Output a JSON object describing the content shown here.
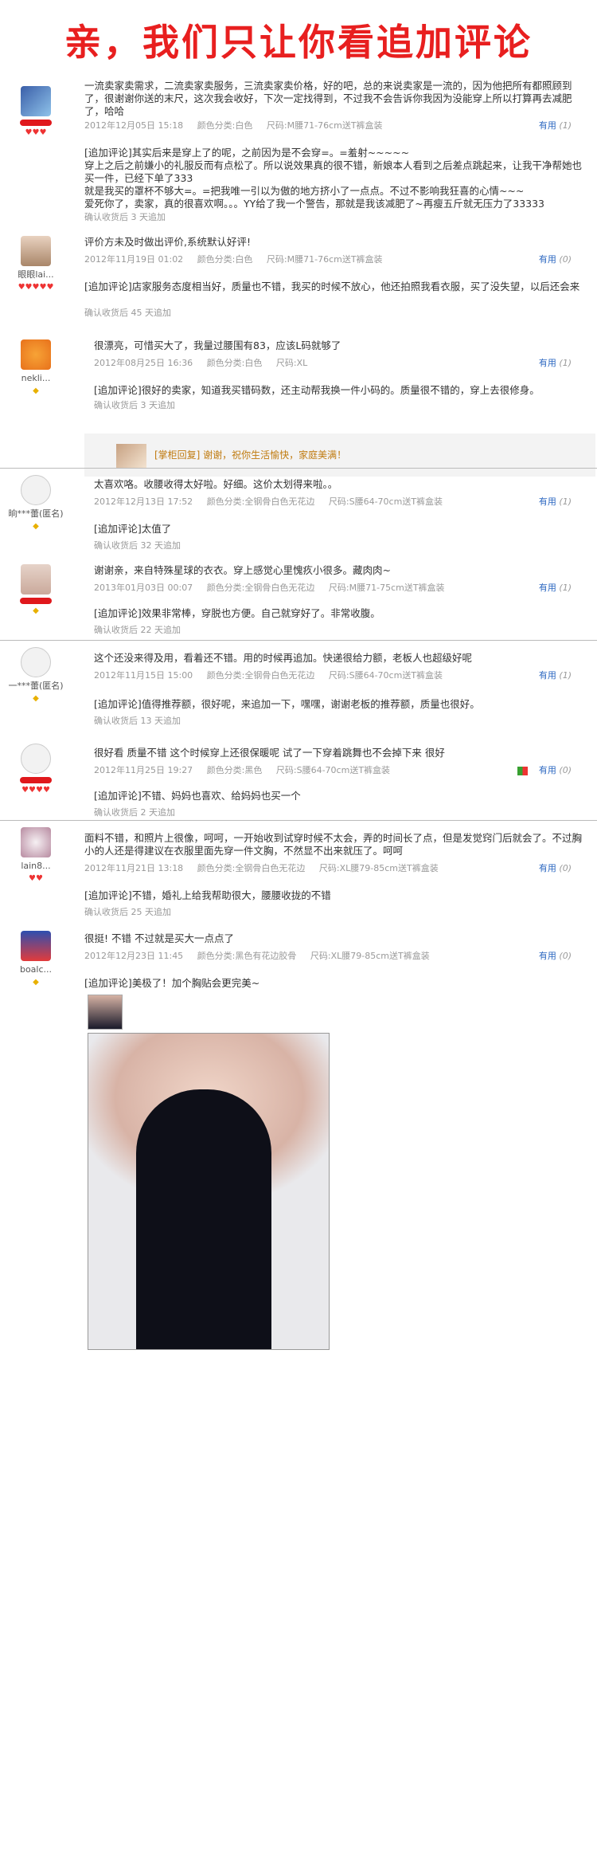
{
  "banner": {
    "title": "亲，我们只让你看追加评论"
  },
  "labels": {
    "helpful": "有用"
  },
  "reviews": [
    {
      "user": {
        "name": "",
        "credit": "♥♥♥"
      },
      "text": "一流卖家卖需求，二流卖家卖服务，三流卖家卖价格，好的吧，总的来说卖家是一流的，因为他把所有都照顾到了，很谢谢你送的末尺，这次我会收好，下次一定找得到，不过我不会告诉你我因为没能穿上所以打算再去减肥了，哈哈",
      "date": "2012年12月05日 15:18",
      "color": "颜色分类:白色",
      "size": "尺码:M腰71-76cm送T裤盒装",
      "helpful_count": "(1)",
      "followup": "[追加评论]其实后来是穿上了的呢，之前因为是不会穿=。=羞射~~~~~\n穿上之后之前嫌小的礼服反而有点松了。所以说效果真的很不错，新娘本人看到之后差点跳起来，让我干净帮她也买一件，已经下单了333\n就是我买的罩杯不够大=。=把我唯一引以为傲的地方挤小了一点点。不过不影响我狂喜的心情~~~\n爱死你了，卖家，真的很喜欢啊。。。YY给了我一个警告，那就是我该减肥了~再瘦五斤就无压力了33333",
      "followup_date": "确认收货后 3 天追加"
    },
    {
      "user": {
        "name": "眼眼lai...",
        "credit": "♥♥♥♥♥"
      },
      "text": "评价方未及时做出评价,系统默认好评!",
      "date": "2012年11月19日 01:02",
      "color": "颜色分类:白色",
      "size": "尺码:M腰71-76cm送T裤盒装",
      "helpful_count": "(0)",
      "followup": "[追加评论]店家服务态度相当好，质量也不错，我买的时候不放心，他还拍照我看衣服，买了没失望，以后还会来",
      "followup_date": "确认收货后 45 天追加"
    },
    {
      "user": {
        "name": "nekli...",
        "credit": "◆"
      },
      "text": "很漂亮，可惜买大了，我量过腰围有83，应该L码就够了",
      "date": "2012年08月25日 16:36",
      "color": "颜色分类:白色",
      "size": "尺码:XL",
      "helpful_count": "(1)",
      "followup": "[追加评论]很好的卖家，知道我买错码数，还主动帮我换一件小码的。质量很不错的，穿上去很修身。",
      "followup_date": "确认收货后 3 天追加",
      "reply": "[掌柜回复] 谢谢，祝你生活愉快，家庭美满！"
    },
    {
      "user": {
        "name": "晌***蕾(匿名)",
        "credit": "◆"
      },
      "text": "太喜欢咯。收腰收得太好啦。好细。这价太划得来啦。。",
      "date": "2012年12月13日 17:52",
      "color": "颜色分类:全钢骨白色无花边",
      "size": "尺码:S腰64-70cm送T裤盒装",
      "helpful_count": "(1)",
      "followup": "[追加评论]太值了",
      "followup_date": "确认收货后 32 天追加"
    },
    {
      "user": {
        "name": "",
        "credit": "◆"
      },
      "text": "谢谢亲，来自特殊星球的衣衣。穿上感觉心里愧疚小很多。藏肉肉~",
      "date": "2013年01月03日 00:07",
      "color": "颜色分类:全钢骨白色无花边",
      "size": "尺码:M腰71-75cm送T裤盒装",
      "helpful_count": "(1)",
      "followup": "[追加评论]效果非常棒，穿脱也方便。自己就穿好了。非常收腹。",
      "followup_date": "确认收货后 22 天追加"
    },
    {
      "user": {
        "name": "一***蕾(匿名)",
        "credit": "◆"
      },
      "text": "这个还没来得及用，看着还不错。用的时候再追加。快递很给力额，老板人也超级好呢",
      "date": "2012年11月15日 15:00",
      "color": "颜色分类:全钢骨白色无花边",
      "size": "尺码:S腰64-70cm送T裤盒装",
      "helpful_count": "(1)",
      "followup": "[追加评论]值得推荐额，很好呢，来追加一下，嘿嘿，谢谢老板的推荐额，质量也很好。",
      "followup_date": "确认收货后 13 天追加"
    },
    {
      "user": {
        "name": "",
        "credit": "♥♥♥♥"
      },
      "text": "很好看 质量不错 这个时候穿上还很保暖呢 试了一下穿着跳舞也不会掉下来 很好",
      "date": "2012年11月25日 19:27",
      "color": "颜色分类:黑色",
      "size": "尺码:S腰64-70cm送T裤盒装",
      "helpful_count": "(0)",
      "followup": "[追加评论]不错、妈妈也喜欢、给妈妈也买一个",
      "followup_date": "确认收货后 2 天追加"
    },
    {
      "user": {
        "name": "lain8...",
        "credit": "♥♥"
      },
      "text": "面料不错，和照片上很像，呵呵，一开始收到试穿时候不太会，弄的时间长了点，但是发觉窍门后就会了。不过胸小的人还是得建议在衣服里面先穿一件文胸，不然显不出来就压了。呵呵",
      "date": "2012年11月21日 13:18",
      "color": "颜色分类:全钢骨白色无花边",
      "size": "尺码:XL腰79-85cm送T裤盒装",
      "helpful_count": "(0)",
      "followup": "[追加评论]不错，婚礼上给我帮助很大，腰腰收拢的不错",
      "followup_date": "确认收货后 25 天追加"
    },
    {
      "user": {
        "name": "boalc...",
        "credit": "◆"
      },
      "text": "很挺! 不错 不过就是买大一点点了",
      "date": "2012年12月23日 11:45",
      "color": "颜色分类:黑色有花边胶骨",
      "size": "尺码:XL腰79-85cm送T裤盒装",
      "helpful_count": "(0)",
      "followup": "[追加评论]美极了！加个胸贴会更完美~"
    }
  ]
}
